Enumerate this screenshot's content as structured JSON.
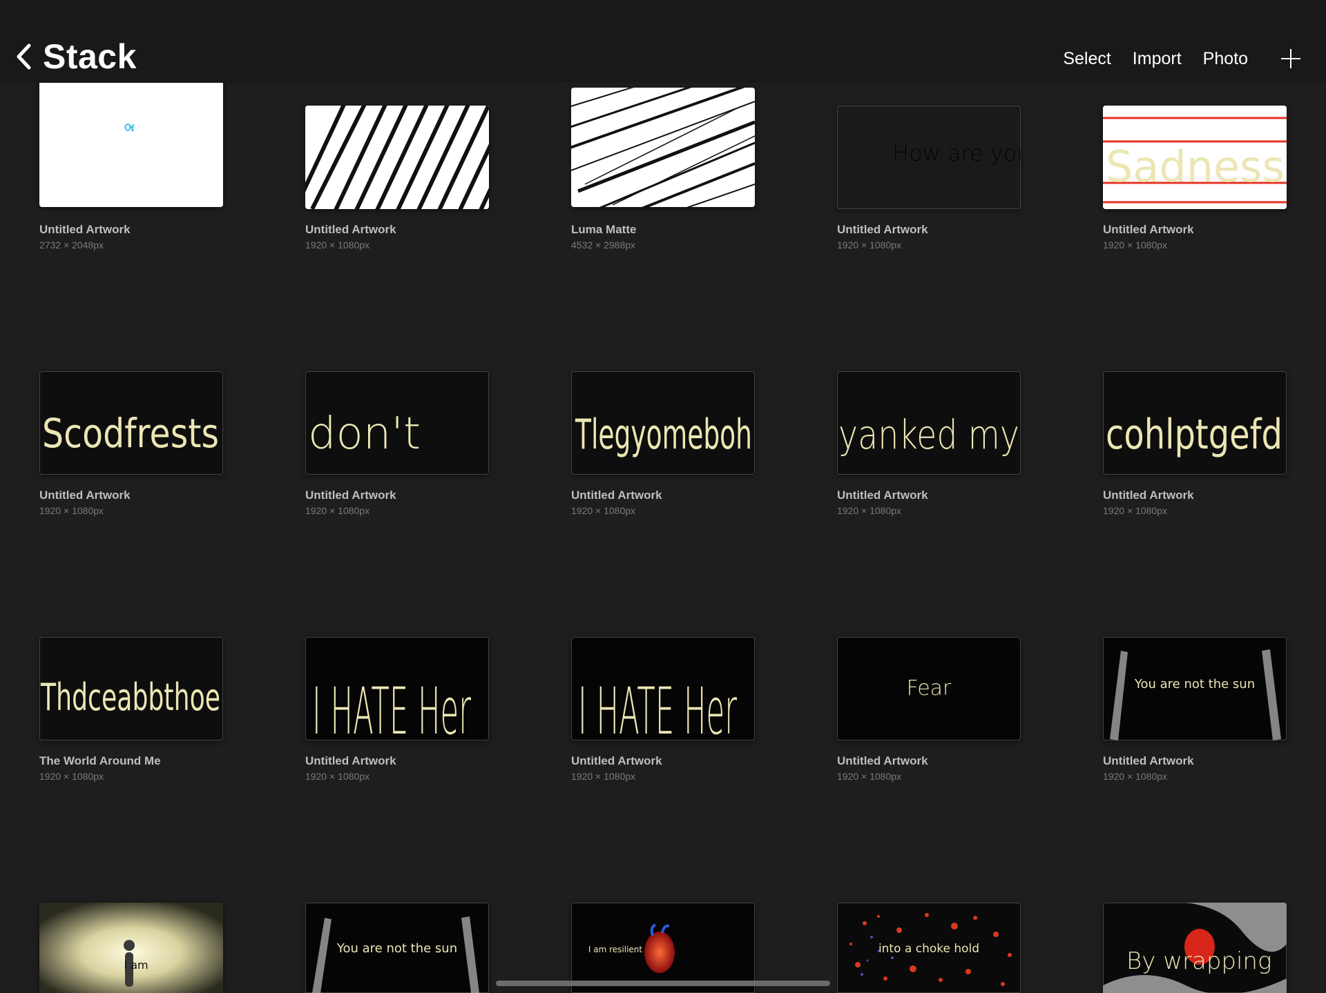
{
  "header": {
    "title": "Stack",
    "actions": {
      "select": "Select",
      "import": "Import",
      "photo": "Photo"
    }
  },
  "artworks": [
    {
      "name": "Untitled Artwork",
      "size": "2732 × 2048px"
    },
    {
      "name": "Untitled Artwork",
      "size": "1920 × 1080px"
    },
    {
      "name": "Luma Matte",
      "size": "4532 × 2988px"
    },
    {
      "name": "Untitled Artwork",
      "size": "1920 × 1080px",
      "text": "How are you"
    },
    {
      "name": "Untitled Artwork",
      "size": "1920 × 1080px",
      "text": "Sadness"
    },
    {
      "name": "Untitled Artwork",
      "size": "1920 × 1080px",
      "text": "Scodfrests"
    },
    {
      "name": "Untitled Artwork",
      "size": "1920 × 1080px",
      "text": "don't"
    },
    {
      "name": "Untitled Artwork",
      "size": "1920 × 1080px",
      "text": "Tlegyomeboh"
    },
    {
      "name": "Untitled Artwork",
      "size": "1920 × 1080px",
      "text": "yanked my"
    },
    {
      "name": "Untitled Artwork",
      "size": "1920 × 1080px",
      "text": "cohlptgefd"
    },
    {
      "name": "The World Around Me",
      "size": "1920 × 1080px",
      "text": "Thdceabbthoe"
    },
    {
      "name": "Untitled Artwork",
      "size": "1920 × 1080px",
      "text": "I HATE Her"
    },
    {
      "name": "Untitled Artwork",
      "size": "1920 × 1080px",
      "text": "I HATE Her"
    },
    {
      "name": "Untitled Artwork",
      "size": "1920 × 1080px",
      "text": "Fear"
    },
    {
      "name": "Untitled Artwork",
      "size": "1920 × 1080px",
      "text": "You are not the sun"
    },
    {
      "name": "",
      "size": "",
      "text": "I am"
    },
    {
      "name": "",
      "size": "",
      "text": "You are not the sun"
    },
    {
      "name": "",
      "size": "",
      "text": "I am resilient"
    },
    {
      "name": "",
      "size": "",
      "text": "into a choke hold"
    },
    {
      "name": "",
      "size": "",
      "text": "By wrapping"
    }
  ],
  "colors": {
    "background": "#1e1e1f",
    "topbar": "#191919",
    "chalk": "#ece6b4",
    "accent_red": "#e53224"
  },
  "icons": {
    "back": "chevron-left-icon",
    "add": "plus-icon"
  }
}
